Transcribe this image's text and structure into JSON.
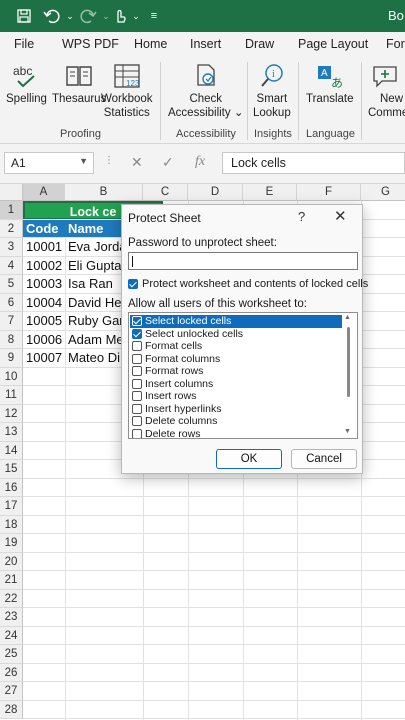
{
  "window": {
    "title": "Bo"
  },
  "quick_access": {
    "icons": [
      "save-icon",
      "undo-icon",
      "redo-icon",
      "touch-mode-icon",
      "customize-icon"
    ]
  },
  "tabs": [
    "File",
    "WPS PDF",
    "Home",
    "Insert",
    "Draw",
    "Page Layout",
    "For"
  ],
  "ribbon": {
    "proofing": {
      "label": "Proofing",
      "spelling": "Spelling",
      "thesaurus": "Thesaurus",
      "workbook_stats": [
        "Workbook",
        "Statistics"
      ]
    },
    "accessibility": {
      "label": "Accessibility",
      "check": [
        "Check",
        "Accessibility"
      ],
      "dropdown_mark": "⌄"
    },
    "insights": {
      "label": "Insights",
      "smart_lookup": [
        "Smart",
        "Lookup"
      ]
    },
    "language": {
      "label": "Language",
      "translate": "Translate"
    },
    "comments": {
      "new": [
        "New",
        "Comme"
      ]
    }
  },
  "formula_bar": {
    "name_box": "A1",
    "dots": "⋮",
    "cancel": "✕",
    "enter": "✓",
    "fx": "fx",
    "content": "Lock cells"
  },
  "grid": {
    "columns": [
      "A",
      "B",
      "C",
      "D",
      "E",
      "F",
      "G"
    ],
    "rows": [
      "1",
      "2",
      "3",
      "4",
      "5",
      "6",
      "7",
      "8",
      "9",
      "10",
      "11",
      "12",
      "13",
      "14",
      "15",
      "16",
      "17",
      "18",
      "19",
      "20",
      "21",
      "22",
      "23",
      "24",
      "25",
      "26",
      "27",
      "28"
    ],
    "merged_title": "Lock ce",
    "header": {
      "code": "Code",
      "name": "Name"
    },
    "data": [
      {
        "code": "10001",
        "name": "Eva Jorda"
      },
      {
        "code": "10002",
        "name": "Eli Gupta"
      },
      {
        "code": "10003",
        "name": "Isa Ran"
      },
      {
        "code": "10004",
        "name": "David He"
      },
      {
        "code": "10005",
        "name": "Ruby Gam"
      },
      {
        "code": "10006",
        "name": "Adam Me"
      },
      {
        "code": "10007",
        "name": "Mateo Di"
      }
    ]
  },
  "dialog": {
    "title": "Protect Sheet",
    "help": "?",
    "close": "✕",
    "password_label": "Password to unprotect sheet:",
    "password_value": "",
    "protect_label": "Protect worksheet and contents of locked cells",
    "protect_checked": true,
    "allow_label": "Allow all users of this worksheet to:",
    "permissions": [
      {
        "label": "Select locked cells",
        "checked": true,
        "highlighted": true
      },
      {
        "label": "Select unlocked cells",
        "checked": true,
        "highlighted": false
      },
      {
        "label": "Format cells",
        "checked": false,
        "highlighted": false
      },
      {
        "label": "Format columns",
        "checked": false,
        "highlighted": false
      },
      {
        "label": "Format rows",
        "checked": false,
        "highlighted": false
      },
      {
        "label": "Insert columns",
        "checked": false,
        "highlighted": false
      },
      {
        "label": "Insert rows",
        "checked": false,
        "highlighted": false
      },
      {
        "label": "Insert hyperlinks",
        "checked": false,
        "highlighted": false
      },
      {
        "label": "Delete columns",
        "checked": false,
        "highlighted": false
      },
      {
        "label": "Delete rows",
        "checked": false,
        "highlighted": false
      }
    ],
    "ok": "OK",
    "cancel": "Cancel"
  },
  "colors": {
    "title_bar": "#1e7145",
    "merged_fill": "#22a150",
    "header_fill": "#1f7bbd",
    "accent": "#0f6cbd"
  }
}
